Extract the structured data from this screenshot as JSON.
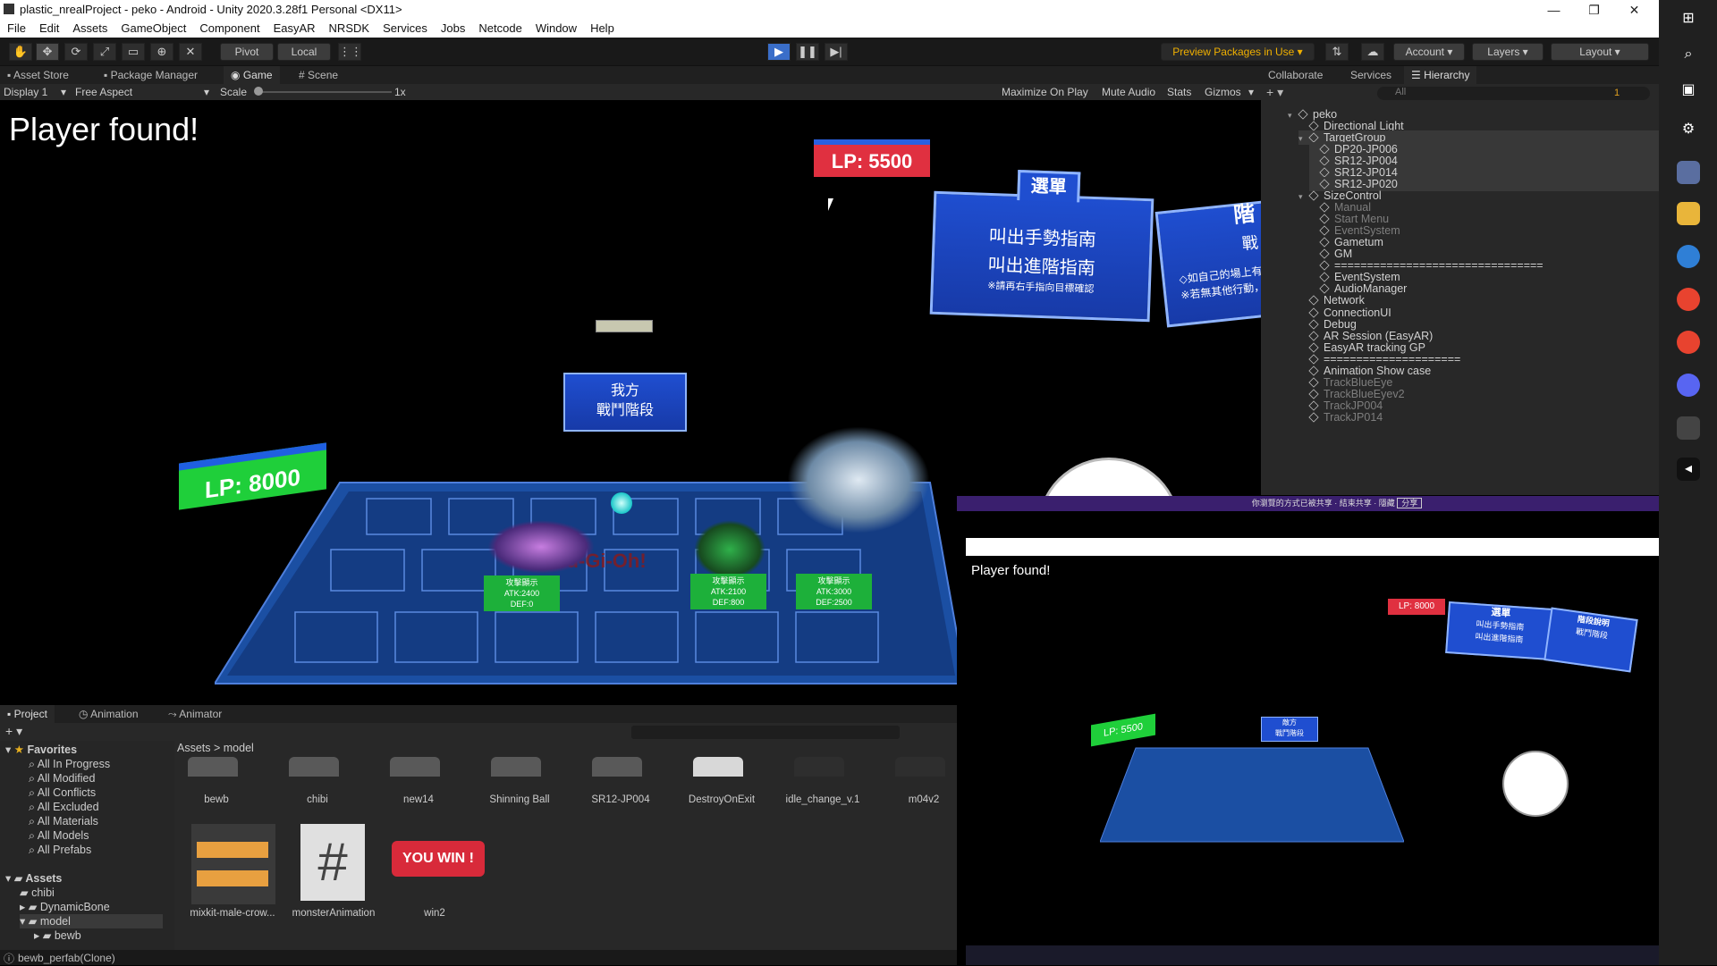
{
  "window": {
    "title": "plastic_nrealProject - peko - Android - Unity 2020.3.28f1 Personal <DX11>",
    "min": "—",
    "max": "❐",
    "close": "✕"
  },
  "menu": [
    "File",
    "Edit",
    "Assets",
    "GameObject",
    "Component",
    "EasyAR",
    "NRSDK",
    "Services",
    "Jobs",
    "Netcode",
    "Window",
    "Help"
  ],
  "toolbar": {
    "pivot": "Pivot",
    "local": "Local",
    "preview": "Preview Packages in Use",
    "account": "Account",
    "layers": "Layers",
    "layout": "Layout"
  },
  "tabs_top": {
    "asset_store": "Asset Store",
    "package_manager": "Package Manager",
    "game": "Game",
    "scene": "Scene",
    "collaborate": "Collaborate",
    "services": "Services",
    "hierarchy": "Hierarchy"
  },
  "gamebar": {
    "display": "Display 1",
    "aspect": "Free Aspect",
    "scale": "Scale",
    "scale_val": "1x",
    "maximize": "Maximize On Play",
    "mute": "Mute Audio",
    "stats": "Stats",
    "gizmos": "Gizmos"
  },
  "game": {
    "player_found": "Player found!",
    "lp_enemy": "LP: 5500",
    "lp_self": "LP: 8000",
    "phase_line1": "我方",
    "phase_line2": "戰鬥階段",
    "menu_title": "選單",
    "menu_item1": "叫出手勢指南",
    "menu_item2": "叫出進階指南",
    "menu_note": "※請再右手指向目標確認",
    "side_title": "階",
    "side_sub": "戰",
    "side_note1": "◇如自己的場上有",
    "side_note2": "※若無其他行動，",
    "cards": [
      {
        "name": "攻擊顯示",
        "atk": "ATK:2400",
        "def": "DEF:0"
      },
      {
        "name": "攻擊顯示",
        "atk": "ATK:2100",
        "def": "DEF:800"
      },
      {
        "name": "攻擊顯示",
        "atk": "ATK:3000",
        "def": "DEF:2500"
      }
    ],
    "board_text": "Yu-Gi-Oh!"
  },
  "hierarchy": {
    "search": "All",
    "rows": [
      {
        "label": "peko",
        "indent": 0,
        "dim": false
      },
      {
        "label": "Directional Light",
        "indent": 1,
        "dim": false
      },
      {
        "label": "TargetGroup",
        "indent": 1,
        "dim": false
      },
      {
        "label": "DP20-JP006",
        "indent": 2,
        "dim": false
      },
      {
        "label": "SR12-JP004",
        "indent": 2,
        "dim": false
      },
      {
        "label": "SR12-JP014",
        "indent": 2,
        "dim": false
      },
      {
        "label": "SR12-JP020",
        "indent": 2,
        "dim": false
      },
      {
        "label": "SizeControl",
        "indent": 1,
        "dim": false
      },
      {
        "label": "Manual",
        "indent": 2,
        "dim": true
      },
      {
        "label": "Start Menu",
        "indent": 2,
        "dim": true
      },
      {
        "label": "EventSystem",
        "indent": 2,
        "dim": true
      },
      {
        "label": "Gametum",
        "indent": 2,
        "dim": false
      },
      {
        "label": "GM",
        "indent": 2,
        "dim": false
      },
      {
        "label": "================================",
        "indent": 2,
        "dim": false
      },
      {
        "label": "EventSystem",
        "indent": 2,
        "dim": false
      },
      {
        "label": "AudioManager",
        "indent": 2,
        "dim": false
      },
      {
        "label": "Network",
        "indent": 1,
        "dim": false
      },
      {
        "label": "ConnectionUI",
        "indent": 1,
        "dim": false
      },
      {
        "label": "Debug",
        "indent": 1,
        "dim": false
      },
      {
        "label": "AR Session (EasyAR)",
        "indent": 1,
        "dim": false
      },
      {
        "label": "EasyAR tracking GP",
        "indent": 1,
        "dim": false
      },
      {
        "label": "=====================",
        "indent": 1,
        "dim": false
      },
      {
        "label": "Animation Show case",
        "indent": 1,
        "dim": false
      },
      {
        "label": "TrackBlueEye",
        "indent": 1,
        "dim": true
      },
      {
        "label": "TrackBlueEyev2",
        "indent": 1,
        "dim": true
      },
      {
        "label": "TrackJP004",
        "indent": 1,
        "dim": true
      },
      {
        "label": "TrackJP014",
        "indent": 1,
        "dim": true
      }
    ],
    "badge": "1"
  },
  "bottom_tabs": {
    "project": "Project",
    "animation": "Animation",
    "animator": "Animator"
  },
  "favorites": {
    "title": "Favorites",
    "items": [
      "All In Progress",
      "All Modified",
      "All Conflicts",
      "All Excluded",
      "All Materials",
      "All Models",
      "All Prefabs"
    ]
  },
  "assets_tree": {
    "title": "Assets",
    "items": [
      "chibi",
      "DynamicBone",
      "model",
      "bewb"
    ]
  },
  "breadcrumb": [
    "Assets",
    "model"
  ],
  "assets_row1": [
    "bewb",
    "chibi",
    "new14",
    "Shinning Ball",
    "SR12-JP004",
    "DestroyOnExit",
    "idle_change_v.1",
    "m04v2"
  ],
  "assets_row2": [
    "mixkit-male-crow...",
    "monsterAnimation",
    "win2"
  ],
  "win_label": "YOU WIN !",
  "status": "bewb_perfab(Clone)",
  "inset": {
    "banner": "你瀏覽的方式已被共享 · 結束共享 · 隱藏",
    "banner_btn": "分享",
    "player_found": "Player found!",
    "lp_top": "LP: 8000",
    "lp_left": "LP: 5500",
    "menu_title": "選單",
    "menu_item1": "叫出手勢指南",
    "menu_item2": "叫出進階指南",
    "side_title": "階段說明",
    "side_sub": "戰鬥階段",
    "phase1": "敵方",
    "phase2": "戰鬥階段"
  }
}
